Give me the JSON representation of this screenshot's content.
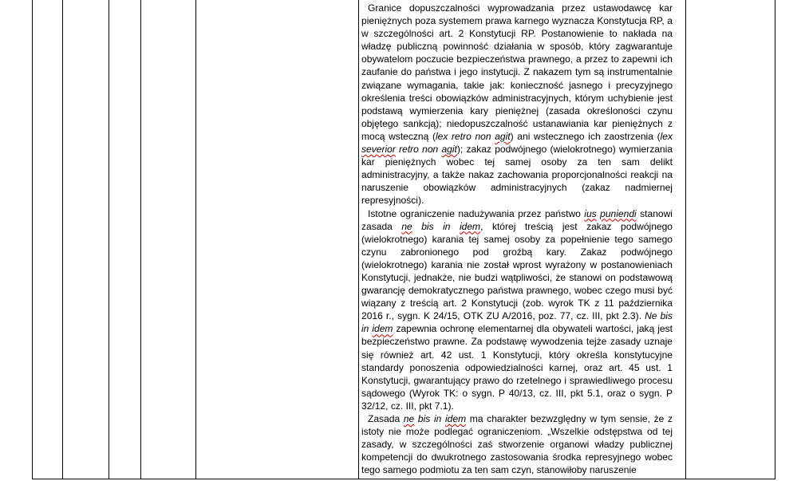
{
  "document": {
    "paragraphs": [
      {
        "segments": [
          {
            "text": "Granice dopuszczalności wyprowadzania przez ustawodawcę kar pieniężnych poza systemem prawa karnego wyznacza Konstytucja RP, a w szczególności art. 2 Konstytucji RP. Postanowienie to nakłada na władzę publiczną powinność działania w sposób, który zagwarantuje obywatelom poczucie bezpieczeństwa prawnego, a przez to zapewni ich zaufanie do państwa i jego instytucji. Z nakazem tym są instrumentalnie związane wymagania, takie jak: konieczność jasnego i precyzyjnego określenia treści obowiązków administracyjnych, którym uchybienie jest podstawą wymierzenia kary pieniężnej (zasada określoności czynu objętego sankcją); niedopuszczalność ustanawiania kar pieniężnych z mocą wsteczną (",
            "style": "normal"
          },
          {
            "text": "lex retro non ",
            "style": "italic"
          },
          {
            "text": "agit",
            "style": "italic-spell"
          },
          {
            "text": ") ani wstecznego ich zaostrzenia (",
            "style": "normal"
          },
          {
            "text": "lex",
            "style": "italic"
          },
          {
            "text": " ",
            "style": "normal"
          },
          {
            "text": "severior",
            "style": "italic-spell"
          },
          {
            "text": " retro non ",
            "style": "italic"
          },
          {
            "text": "agit",
            "style": "italic-spell"
          },
          {
            "text": "); zakaz podwójnego (wielokrotnego) wymierzania kar pieniężnych wobec tej samej osoby za ten sam delikt administracyjny, a także nakaz zachowania proporcjonalności reakcji na naruszenie obowiązków administracyjnych (zakaz nadmiernej represyjności).",
            "style": "normal"
          }
        ]
      },
      {
        "segments": [
          {
            "text": "Istotne ograniczenie nadużywania przez państwo ",
            "style": "normal"
          },
          {
            "text": "ius",
            "style": "italic-spell"
          },
          {
            "text": " ",
            "style": "italic"
          },
          {
            "text": "puniendi",
            "style": "italic-spell"
          },
          {
            "text": " stanowi zasada ",
            "style": "normal"
          },
          {
            "text": "ne",
            "style": "italic-spell"
          },
          {
            "text": " bis in ",
            "style": "italic"
          },
          {
            "text": "idem",
            "style": "italic-spell"
          },
          {
            "text": ", której treścią jest zakaz podwójnego (wielokrotnego) karania tej samej osoby za popełnienie tego samego czynu zabronionego pod groźbą kary. Zakaz podwójnego (wielokrotnego) karania nie został wprost wyrażony w postanowieniach Konstytucji, jednakże, nie budzi wątpliwości, że stanowi on podstawową gwarancję demokratycznego państwa prawnego, wobec czego musi być wiązany z treścią art. 2 Konstytucji (zob. wyrok TK z 11 października 2016 r., sygn. K 24/15, OTK ZU A/2016, poz. 77, cz. III, pkt 2.3). ",
            "style": "normal"
          },
          {
            "text": "Ne bis in ",
            "style": "italic"
          },
          {
            "text": "idem",
            "style": "italic-spell"
          },
          {
            "text": " zapewnia ochronę elementarnej dla obywateli wartości, jaką jest bezpieczeństwo prawne. Za podstawę wywodzenia tejże zasady uznaje się również art. 42 ust. 1 Konstytucji, który określa konstytucyjne standardy ponoszenia odpowiedzialności karnej, oraz art. 45 ust. 1 Konstytucji, gwarantujący prawo do rzetelnego i sprawiedliwego procesu sądowego (Wyrok TK: o sygn. P 40/13, cz. III, pkt 5.1, oraz o sygn. P 32/12, cz. III, pkt 7.1).",
            "style": "normal"
          }
        ]
      },
      {
        "segments": [
          {
            "text": "Zasada ",
            "style": "normal"
          },
          {
            "text": "ne",
            "style": "italic-spell"
          },
          {
            "text": " bis in ",
            "style": "italic"
          },
          {
            "text": "idem",
            "style": "italic-spell"
          },
          {
            "text": " ma charakter bezwzględny w tym sensie, że z istoty nie może podlegać ograniczeniom. „Wszelkie odstępstwa od tej zasady, w szczególności zaś stworzenie organowi władzy publicznej kompetencji do dwukrotnego zastosowania środka represyjnego wobec tego samego podmiotu za ten sam czyn, stanowiłoby naruszenie",
            "style": "normal"
          }
        ]
      }
    ]
  }
}
